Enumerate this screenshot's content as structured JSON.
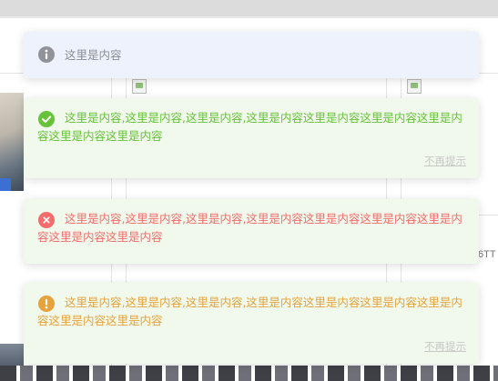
{
  "notifications": [
    {
      "type": "info",
      "icon": "info-icon",
      "color": "#909399",
      "message": "这里是内容"
    },
    {
      "type": "success",
      "icon": "check-icon",
      "color": "#67c23a",
      "message": "这里是内容,这里是内容,这里是内容,这里是内容这里是内容这里是内容这里是内容这里是内容这里是内容",
      "dismiss_label": "不再提示"
    },
    {
      "type": "error",
      "icon": "close-icon",
      "color": "#f56c6c",
      "message": "这里是内容,这里是内容,这里是内容,这里是内容这里是内容这里是内容这里是内容这里是内容这里是内容"
    },
    {
      "type": "warning",
      "icon": "exclamation-icon",
      "color": "#e6a23c",
      "message": "这里是内容,这里是内容,这里是内容,这里是内容这里是内容这里是内容这里是内容这里是内容这里是内容",
      "dismiss_label": "不再提示"
    }
  ],
  "background": {
    "side_text": "6TT"
  }
}
